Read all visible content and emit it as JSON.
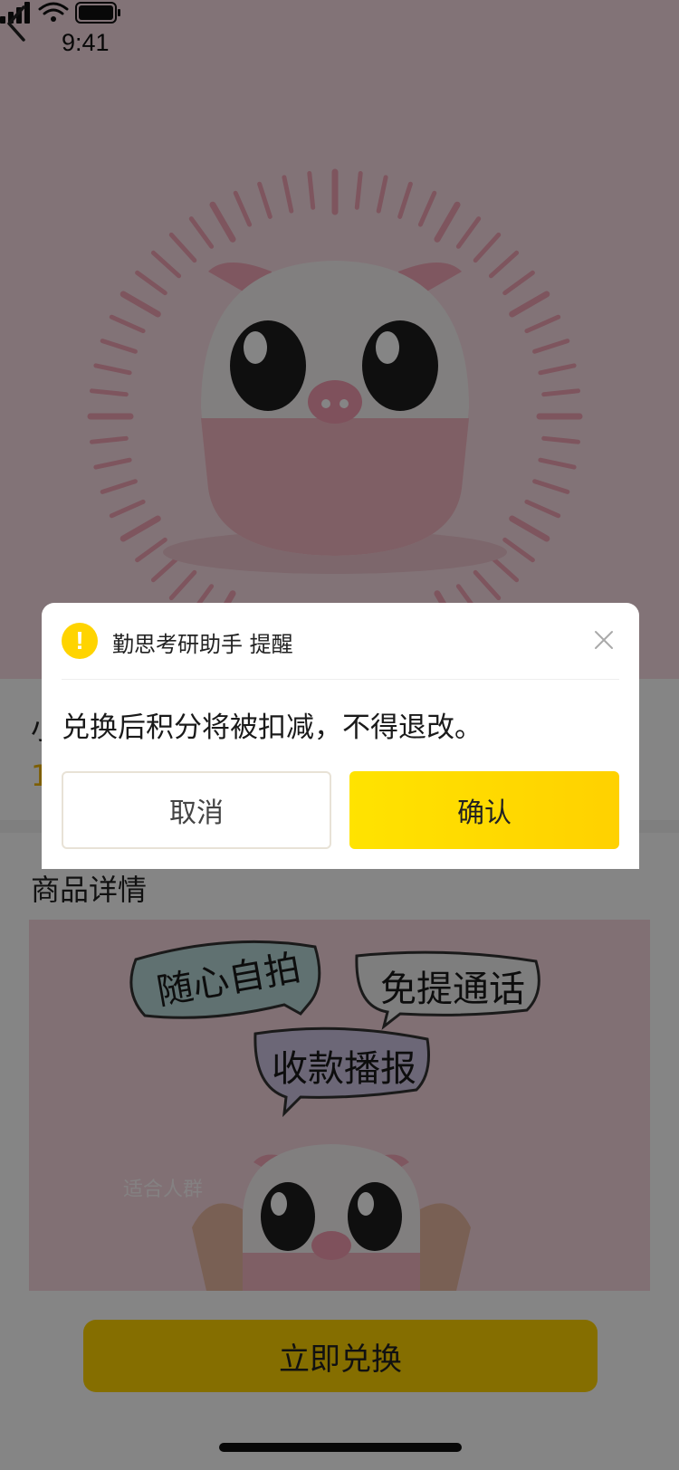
{
  "status_bar": {
    "time": "9:41"
  },
  "product": {
    "title": "小",
    "points": "1"
  },
  "details": {
    "heading": "商品详情",
    "bubbles": [
      "随心自拍",
      "免提通话",
      "收款播报"
    ],
    "suitable_label": "适合人群"
  },
  "bottom": {
    "redeem_label": "立即兑换"
  },
  "dialog": {
    "warning_glyph": "!",
    "title": "勤思考研助手 提醒",
    "message": "兑换后积分将被扣减，不得退改。",
    "cancel_label": "取消",
    "confirm_label": "确认"
  },
  "colors": {
    "accent": "#ffd400",
    "points_text": "#f0b400",
    "hero_background": "#f9dde4"
  }
}
